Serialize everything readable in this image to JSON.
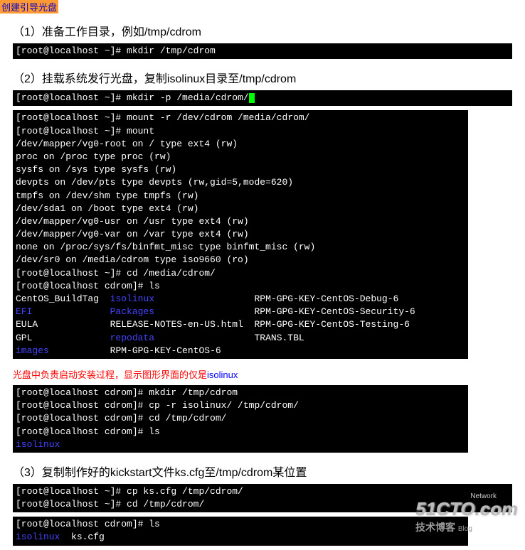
{
  "tag": "创建引导光盘",
  "step1": {
    "title": "（1）准备工作目录，例如/tmp/cdrom",
    "cmd": "[root@localhost ~]# mkdir /tmp/cdrom"
  },
  "step2": {
    "title": "（2）挂载系统发行光盘，复制isolinux目录至/tmp/cdrom",
    "cmd1": "[root@localhost ~]# mkdir -p /media/cdrom/",
    "mount_block": "[root@localhost ~]# mount -r /dev/cdrom /media/cdrom/\n[root@localhost ~]# mount\n/dev/mapper/vg0-root on / type ext4 (rw)\nproc on /proc type proc (rw)\nsysfs on /sys type sysfs (rw)\ndevpts on /dev/pts type devpts (rw,gid=5,mode=620)\ntmpfs on /dev/shm type tmpfs (rw)\n/dev/sda1 on /boot type ext4 (rw)\n/dev/mapper/vg0-usr on /usr type ext4 (rw)\n/dev/mapper/vg0-var on /var type ext4 (rw)\nnone on /proc/sys/fs/binfmt_misc type binfmt_misc (rw)\n/dev/sr0 on /media/cdrom type iso9660 (ro)\n[root@localhost ~]# cd /media/cdrom/\n[root@localhost cdrom]# ls",
    "ls_output": {
      "r1": {
        "c1": "CentOS_BuildTag",
        "c2": "isolinux",
        "c3": "RPM-GPG-KEY-CentOS-Debug-6"
      },
      "r2": {
        "c1": "EFI",
        "c2": "Packages",
        "c3": "RPM-GPG-KEY-CentOS-Security-6"
      },
      "r3": {
        "c1": "EULA",
        "c2": "RELEASE-NOTES-en-US.html",
        "c3": "RPM-GPG-KEY-CentOS-Testing-6"
      },
      "r4": {
        "c1": "GPL",
        "c2": "repodata",
        "c3": "TRANS.TBL"
      },
      "r5": {
        "c1": "images",
        "c2": "RPM-GPG-KEY-CentOS-6",
        "c3": ""
      }
    },
    "note_prefix": "光盘中负责启动安装过程，显示图形界面的仅是",
    "note_highlight": "isolinux",
    "copy_block": "[root@localhost cdrom]# mkdir /tmp/cdrom\n[root@localhost cdrom]# cp -r isolinux/ /tmp/cdrom/\n[root@localhost cdrom]# cd /tmp/cdrom/\n[root@localhost cdrom]# ls",
    "copy_ls": "isolinux"
  },
  "step3": {
    "title": "（3）复制制作好的kickstart文件ks.cfg至/tmp/cdrom某位置",
    "cmd_block": "[root@localhost ~]# cp ks.cfg /tmp/cdrom/\n[root@localhost ~]# cd /tmp/cdrom/",
    "ls_cmd": "[root@localhost cdrom]# ls",
    "ls_out1": "isolinux",
    "ls_out2": "  ks.cfg"
  },
  "watermark": {
    "big": "51CTO.com",
    "sub": "技术博客",
    "blog": "Blog"
  },
  "net": "Network"
}
